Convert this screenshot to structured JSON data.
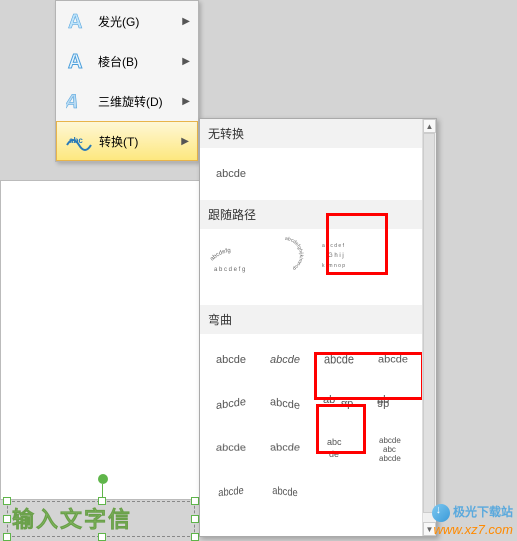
{
  "menu": {
    "items": [
      {
        "label": "发光(G)",
        "icon": "glow"
      },
      {
        "label": "棱台(B)",
        "icon": "bevel"
      },
      {
        "label": "三维旋转(D)",
        "icon": "rotate3d"
      },
      {
        "label": "转换(T)",
        "icon": "transform"
      }
    ]
  },
  "submenu": {
    "sections": {
      "no_transform": {
        "title": "无转换",
        "sample": "abcde"
      },
      "follow_path": {
        "title": "跟随路径"
      },
      "warp": {
        "title": "弯曲",
        "sample": "abcde"
      }
    }
  },
  "wordart": {
    "placeholder_text": "输入文字信"
  },
  "watermark": {
    "site_cn": "极光下载站",
    "site_url": "www.xz7.com"
  }
}
